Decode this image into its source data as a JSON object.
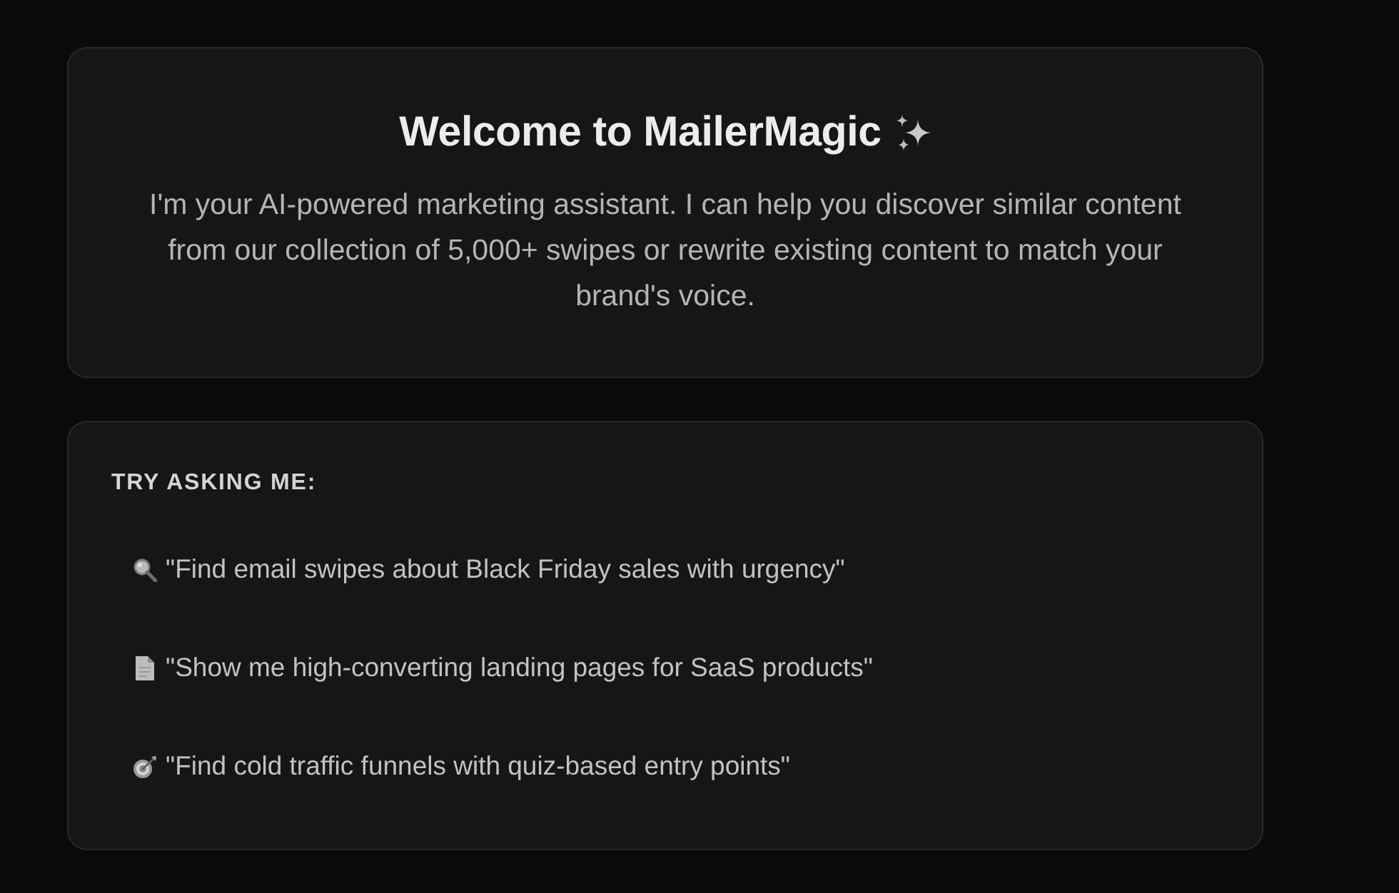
{
  "welcome": {
    "title": "Welcome to MailerMagic",
    "text": "I'm your AI-powered marketing assistant. I can help you discover similar content from our collection of 5,000+ swipes or rewrite existing content to match your brand's voice."
  },
  "suggestions": {
    "heading": "TRY ASKING ME:",
    "items": [
      "\"Find email swipes about Black Friday sales with urgency\"",
      "\"Show me high-converting landing pages for SaaS products\"",
      "\"Find cold traffic funnels with quiz-based entry points\""
    ]
  }
}
